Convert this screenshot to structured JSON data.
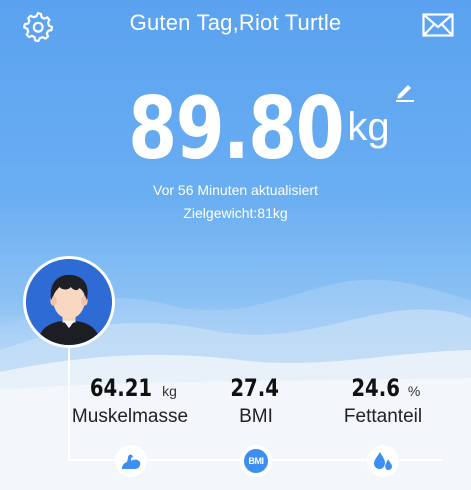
{
  "header": {
    "greeting": "Guten Tag,Riot Turtle",
    "settings_icon": "gear-icon",
    "mail_icon": "envelope-icon"
  },
  "weight": {
    "value": "89.80",
    "unit": "kg",
    "updated": "Vor 56 Minuten aktualisiert",
    "target": "Zielgewicht:81kg",
    "edit_icon": "pencil-icon"
  },
  "metrics": [
    {
      "value": "64.21",
      "unit": "kg",
      "label": "Muskelmasse",
      "icon": "arm-muscle-icon"
    },
    {
      "value": "27.4",
      "unit": "",
      "label": "BMI",
      "icon": "bmi-icon",
      "icon_text": "BMI"
    },
    {
      "value": "24.6",
      "unit": "%",
      "label": "Fettanteil",
      "icon": "fat-drops-icon"
    }
  ],
  "colors": {
    "accent": "#3c8ff0",
    "background_top": "#5aa2f0"
  }
}
